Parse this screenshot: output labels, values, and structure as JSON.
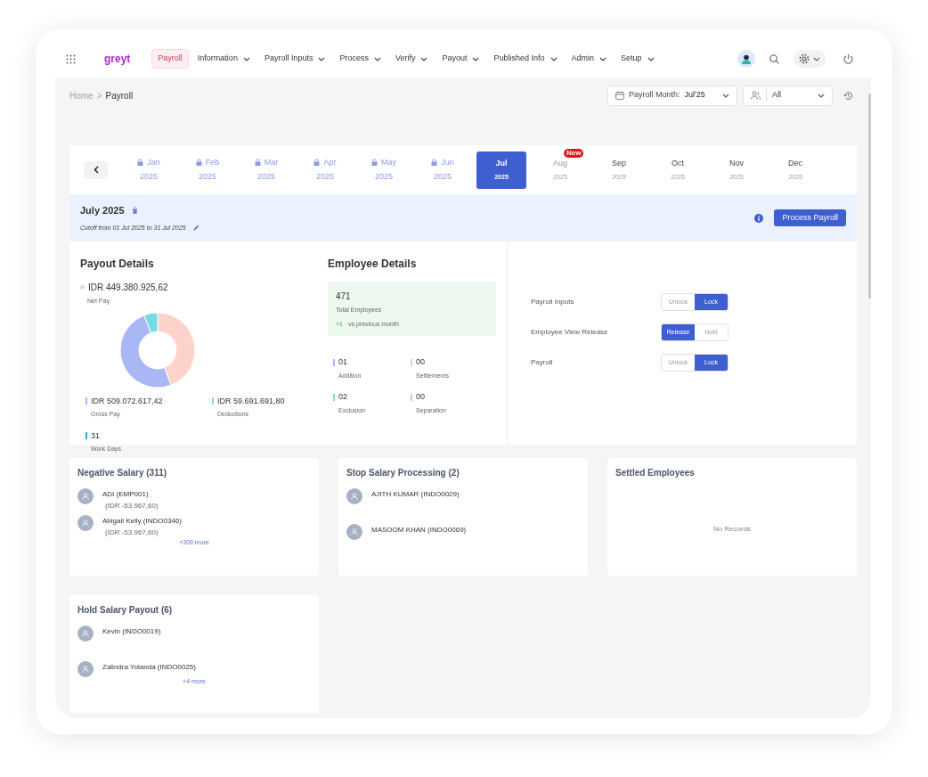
{
  "nav": {
    "logo": "greyt",
    "items": [
      {
        "label": "Payroll",
        "selected": true,
        "dropdown": false
      },
      {
        "label": "Information",
        "selected": false,
        "dropdown": true
      },
      {
        "label": "Payroll Inputs",
        "selected": false,
        "dropdown": true
      },
      {
        "label": "Process",
        "selected": false,
        "dropdown": true
      },
      {
        "label": "Verify",
        "selected": false,
        "dropdown": true
      },
      {
        "label": "Payout",
        "selected": false,
        "dropdown": true
      },
      {
        "label": "Published Info",
        "selected": false,
        "dropdown": true
      },
      {
        "label": "Admin",
        "selected": false,
        "dropdown": true
      },
      {
        "label": "Setup",
        "selected": false,
        "dropdown": true
      }
    ]
  },
  "breadcrumb": {
    "parent": "Home",
    "separator": ">",
    "current": "Payroll"
  },
  "filters": {
    "payroll_month_label": "Payroll Month:",
    "payroll_month": "Jul'25",
    "group": "All"
  },
  "months": [
    {
      "label": "Jan",
      "year": "2025",
      "locked": true,
      "selected": false
    },
    {
      "label": "Feb",
      "year": "2025",
      "locked": true,
      "selected": false
    },
    {
      "label": "Mar",
      "year": "2025",
      "locked": true,
      "selected": false
    },
    {
      "label": "Apr",
      "year": "2025",
      "locked": true,
      "selected": false
    },
    {
      "label": "May",
      "year": "2025",
      "locked": true,
      "selected": false
    },
    {
      "label": "Jun",
      "year": "2025",
      "locked": true,
      "selected": false
    },
    {
      "label": "Jul",
      "year": "2025",
      "locked": false,
      "selected": true
    },
    {
      "label": "Aug",
      "year": "2025",
      "locked": false,
      "selected": false,
      "badge": "New"
    },
    {
      "label": "Sep",
      "year": "2025",
      "locked": false,
      "selected": false
    },
    {
      "label": "Oct",
      "year": "2025",
      "locked": false,
      "selected": false
    },
    {
      "label": "Nov",
      "year": "2025",
      "locked": false,
      "selected": false
    },
    {
      "label": "Dec",
      "year": "2025",
      "locked": false,
      "selected": false
    }
  ],
  "period": {
    "title": "July 2025",
    "cutoff": "Cutoff from 01 Jul 2025 to 31 Jul 2025",
    "action": "Process Payroll"
  },
  "payout": {
    "title": "Payout Details",
    "net": {
      "value": "IDR 449.380.925,62",
      "color": "#fcd3cb"
    },
    "chart_data": {
      "type": "donut",
      "categories": [
        "Net Pay",
        "Gross Pay",
        "Deductions"
      ],
      "series": [
        {
          "values": [
            44.14,
            50.0,
            5.86
          ]
        }
      ]
    },
    "stats": [
      {
        "value": "IDR 509.072.617,42",
        "color": "#a9b8f5"
      },
      {
        "value": "IDR 59.691.691,80",
        "color": "#73dce3"
      },
      {
        "value": "31",
        "label": "Work Days",
        "color": "#2bb3c6"
      }
    ]
  },
  "employees": {
    "title": "Employee Details",
    "total": "471",
    "total_label": "Total Employees",
    "change": "+1",
    "change_label": "vs previous month",
    "stats": [
      {
        "value": "01",
        "label": "Addition",
        "color": "#a9b8f5"
      },
      {
        "value": "00",
        "label": "Settlements",
        "color": "#fcc9c0"
      },
      {
        "value": "02",
        "label": "Exclusion",
        "color": "#7fdcc8"
      },
      {
        "value": "00",
        "label": "Separation",
        "color": "#e4b8f0"
      }
    ]
  },
  "toggles": [
    {
      "label": "Payroll Inputs",
      "options": [
        {
          "label": "Unlock",
          "selected": false
        },
        {
          "label": "Lock",
          "selected": true
        }
      ]
    },
    {
      "label": "Employee View Release",
      "options": [
        {
          "label": "Release",
          "selected": true
        },
        {
          "label": "Hold",
          "selected": false
        }
      ]
    },
    {
      "label": "Payroll",
      "options": [
        {
          "label": "Unlock",
          "selected": false
        },
        {
          "label": "Lock",
          "selected": true
        }
      ]
    }
  ],
  "cards": [
    {
      "title": "Negative Salary (311)",
      "people": [
        {
          "name": "ADI (EMP001)",
          "amount": "(IDR -53.967,60)"
        },
        {
          "name": "Abigail Kelly (INDO0346)",
          "amount": "(IDR -53.967,60)"
        }
      ],
      "more": "+309 more"
    },
    {
      "title": "Stop Salary Processing (2)",
      "people": [
        {
          "name": "AJITH KUMAR (INDO0029)"
        },
        {
          "name": "MASOOM KHAN (INDO0069)"
        }
      ]
    },
    {
      "title": "Settled Employees",
      "empty": "No Records"
    },
    {
      "title": "Hold Salary Payout (6)",
      "people": [
        {
          "name": "Kevin (INDO0019)"
        },
        {
          "name": "Zalindra Yolanda (INDO0025)"
        }
      ],
      "more": "+4 more"
    }
  ]
}
